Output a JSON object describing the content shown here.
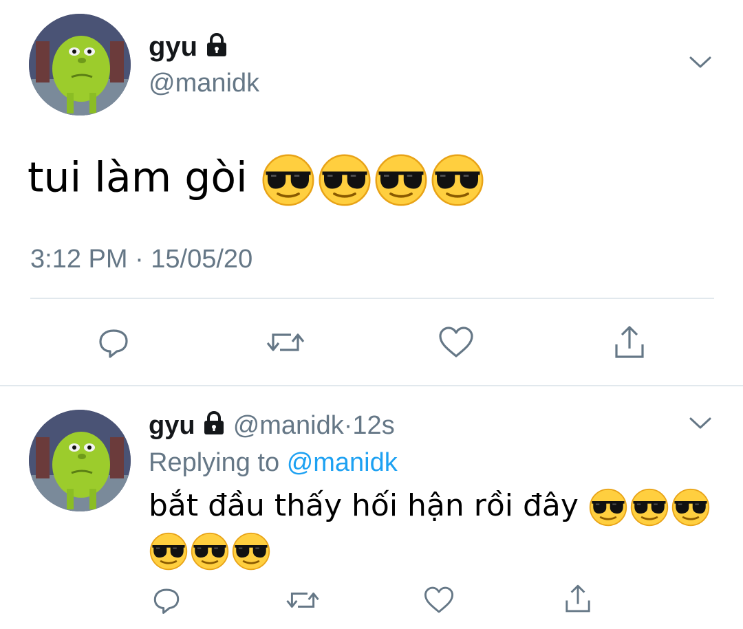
{
  "main_tweet": {
    "display_name": "gyu",
    "handle": "@manidk",
    "text": "tui làm gòi",
    "emoji_count": 4,
    "emoji_icon": "smiling-face-with-sunglasses",
    "timestamp": "3:12 PM · 15/05/20"
  },
  "reply": {
    "display_name": "gyu",
    "handle": "@manidk",
    "separator": "·",
    "age": "12s",
    "replying_prefix": "Replying to",
    "replying_to": "@manidk",
    "text": "bắt đầu thấy hối hận rồi đây",
    "emoji_line1_count": 3,
    "emoji_line2_count": 3
  },
  "colors": {
    "secondary_text": "#657786",
    "link": "#1da1f2",
    "divider": "#e1e8ed"
  }
}
